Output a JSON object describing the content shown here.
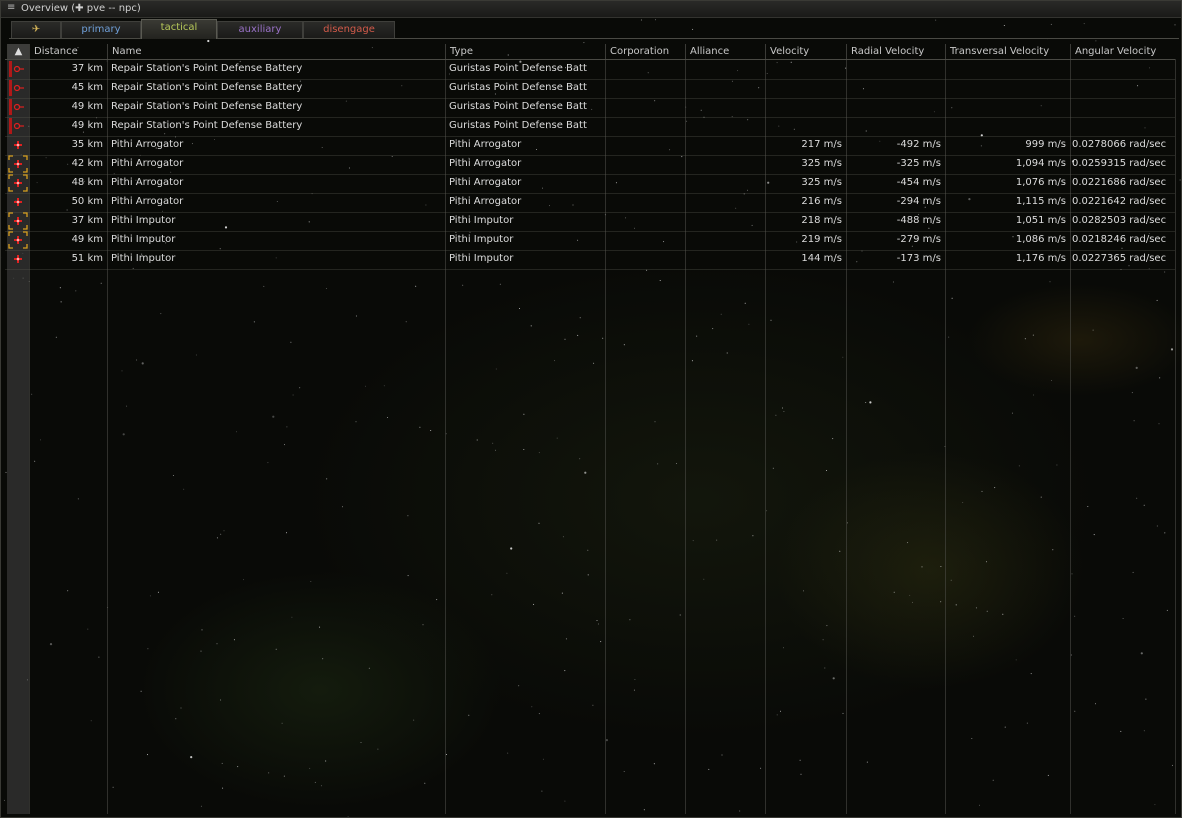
{
  "window": {
    "title": "Overview (✚ pve -- npc)",
    "menu_icon": "hamburger-menu-icon"
  },
  "tabs": [
    {
      "label": "✈",
      "color": "#d9b85a",
      "active": false
    },
    {
      "label": "primary",
      "color": "#6f9fd8",
      "active": false
    },
    {
      "label": "tactical",
      "color": "#b7c95a",
      "active": true
    },
    {
      "label": "auxiliary",
      "color": "#9a72c8",
      "active": false
    },
    {
      "label": "disengage",
      "color": "#d25a4a",
      "active": false
    }
  ],
  "columns": {
    "sort": "▲",
    "distance": "Distance",
    "name": "Name",
    "type": "Type",
    "corporation": "Corporation",
    "alliance": "Alliance",
    "velocity": "Velocity",
    "radial": "Radial Velocity",
    "transversal": "Transversal Velocity",
    "angular": "Angular Velocity"
  },
  "rows": [
    {
      "icon": "structure-hostile-icon",
      "targeted": false,
      "distance": "37 km",
      "name": "Repair Station's Point Defense Battery",
      "type": "Guristas Point Defense Batt",
      "corporation": "",
      "alliance": "",
      "velocity": "",
      "radial": "",
      "transversal": "",
      "angular": ""
    },
    {
      "icon": "structure-hostile-icon",
      "targeted": false,
      "distance": "45 km",
      "name": "Repair Station's Point Defense Battery",
      "type": "Guristas Point Defense Batt",
      "corporation": "",
      "alliance": "",
      "velocity": "",
      "radial": "",
      "transversal": "",
      "angular": ""
    },
    {
      "icon": "structure-hostile-icon",
      "targeted": false,
      "distance": "49 km",
      "name": "Repair Station's Point Defense Battery",
      "type": "Guristas Point Defense Batt",
      "corporation": "",
      "alliance": "",
      "velocity": "",
      "radial": "",
      "transversal": "",
      "angular": ""
    },
    {
      "icon": "structure-hostile-icon",
      "targeted": false,
      "distance": "49 km",
      "name": "Repair Station's Point Defense Battery",
      "type": "Guristas Point Defense Batt",
      "corporation": "",
      "alliance": "",
      "velocity": "",
      "radial": "",
      "transversal": "",
      "angular": ""
    },
    {
      "icon": "frigate-hostile-icon",
      "targeted": false,
      "distance": "35 km",
      "name": "Pithi Arrogator",
      "type": "Pithi Arrogator",
      "corporation": "",
      "alliance": "",
      "velocity": "217 m/s",
      "radial": "-492 m/s",
      "transversal": "999 m/s",
      "angular": "0.0278066 rad/sec"
    },
    {
      "icon": "frigate-hostile-icon",
      "targeted": true,
      "distance": "42 km",
      "name": "Pithi Arrogator",
      "type": "Pithi Arrogator",
      "corporation": "",
      "alliance": "",
      "velocity": "325 m/s",
      "radial": "-325 m/s",
      "transversal": "1,094 m/s",
      "angular": "0.0259315 rad/sec"
    },
    {
      "icon": "frigate-hostile-icon",
      "targeted": true,
      "distance": "48 km",
      "name": "Pithi Arrogator",
      "type": "Pithi Arrogator",
      "corporation": "",
      "alliance": "",
      "velocity": "325 m/s",
      "radial": "-454 m/s",
      "transversal": "1,076 m/s",
      "angular": "0.0221686 rad/sec"
    },
    {
      "icon": "frigate-hostile-icon",
      "targeted": false,
      "distance": "50 km",
      "name": "Pithi Arrogator",
      "type": "Pithi Arrogator",
      "corporation": "",
      "alliance": "",
      "velocity": "216 m/s",
      "radial": "-294 m/s",
      "transversal": "1,115 m/s",
      "angular": "0.0221642 rad/sec"
    },
    {
      "icon": "frigate-hostile-icon",
      "targeted": true,
      "distance": "37 km",
      "name": "Pithi Imputor",
      "type": "Pithi Imputor",
      "corporation": "",
      "alliance": "",
      "velocity": "218 m/s",
      "radial": "-488 m/s",
      "transversal": "1,051 m/s",
      "angular": "0.0282503 rad/sec"
    },
    {
      "icon": "frigate-hostile-icon",
      "targeted": true,
      "distance": "49 km",
      "name": "Pithi Imputor",
      "type": "Pithi Imputor",
      "corporation": "",
      "alliance": "",
      "velocity": "219 m/s",
      "radial": "-279 m/s",
      "transversal": "1,086 m/s",
      "angular": "0.0218246 rad/sec"
    },
    {
      "icon": "frigate-hostile-icon",
      "targeted": false,
      "distance": "51 km",
      "name": "Pithi Imputor",
      "type": "Pithi Imputor",
      "corporation": "",
      "alliance": "",
      "velocity": "144 m/s",
      "radial": "-173 m/s",
      "transversal": "1,176 m/s",
      "angular": "0.0227365 rad/sec"
    }
  ],
  "colors": {
    "hostile_red": "#e02020",
    "target_bracket": "#d8a020"
  }
}
